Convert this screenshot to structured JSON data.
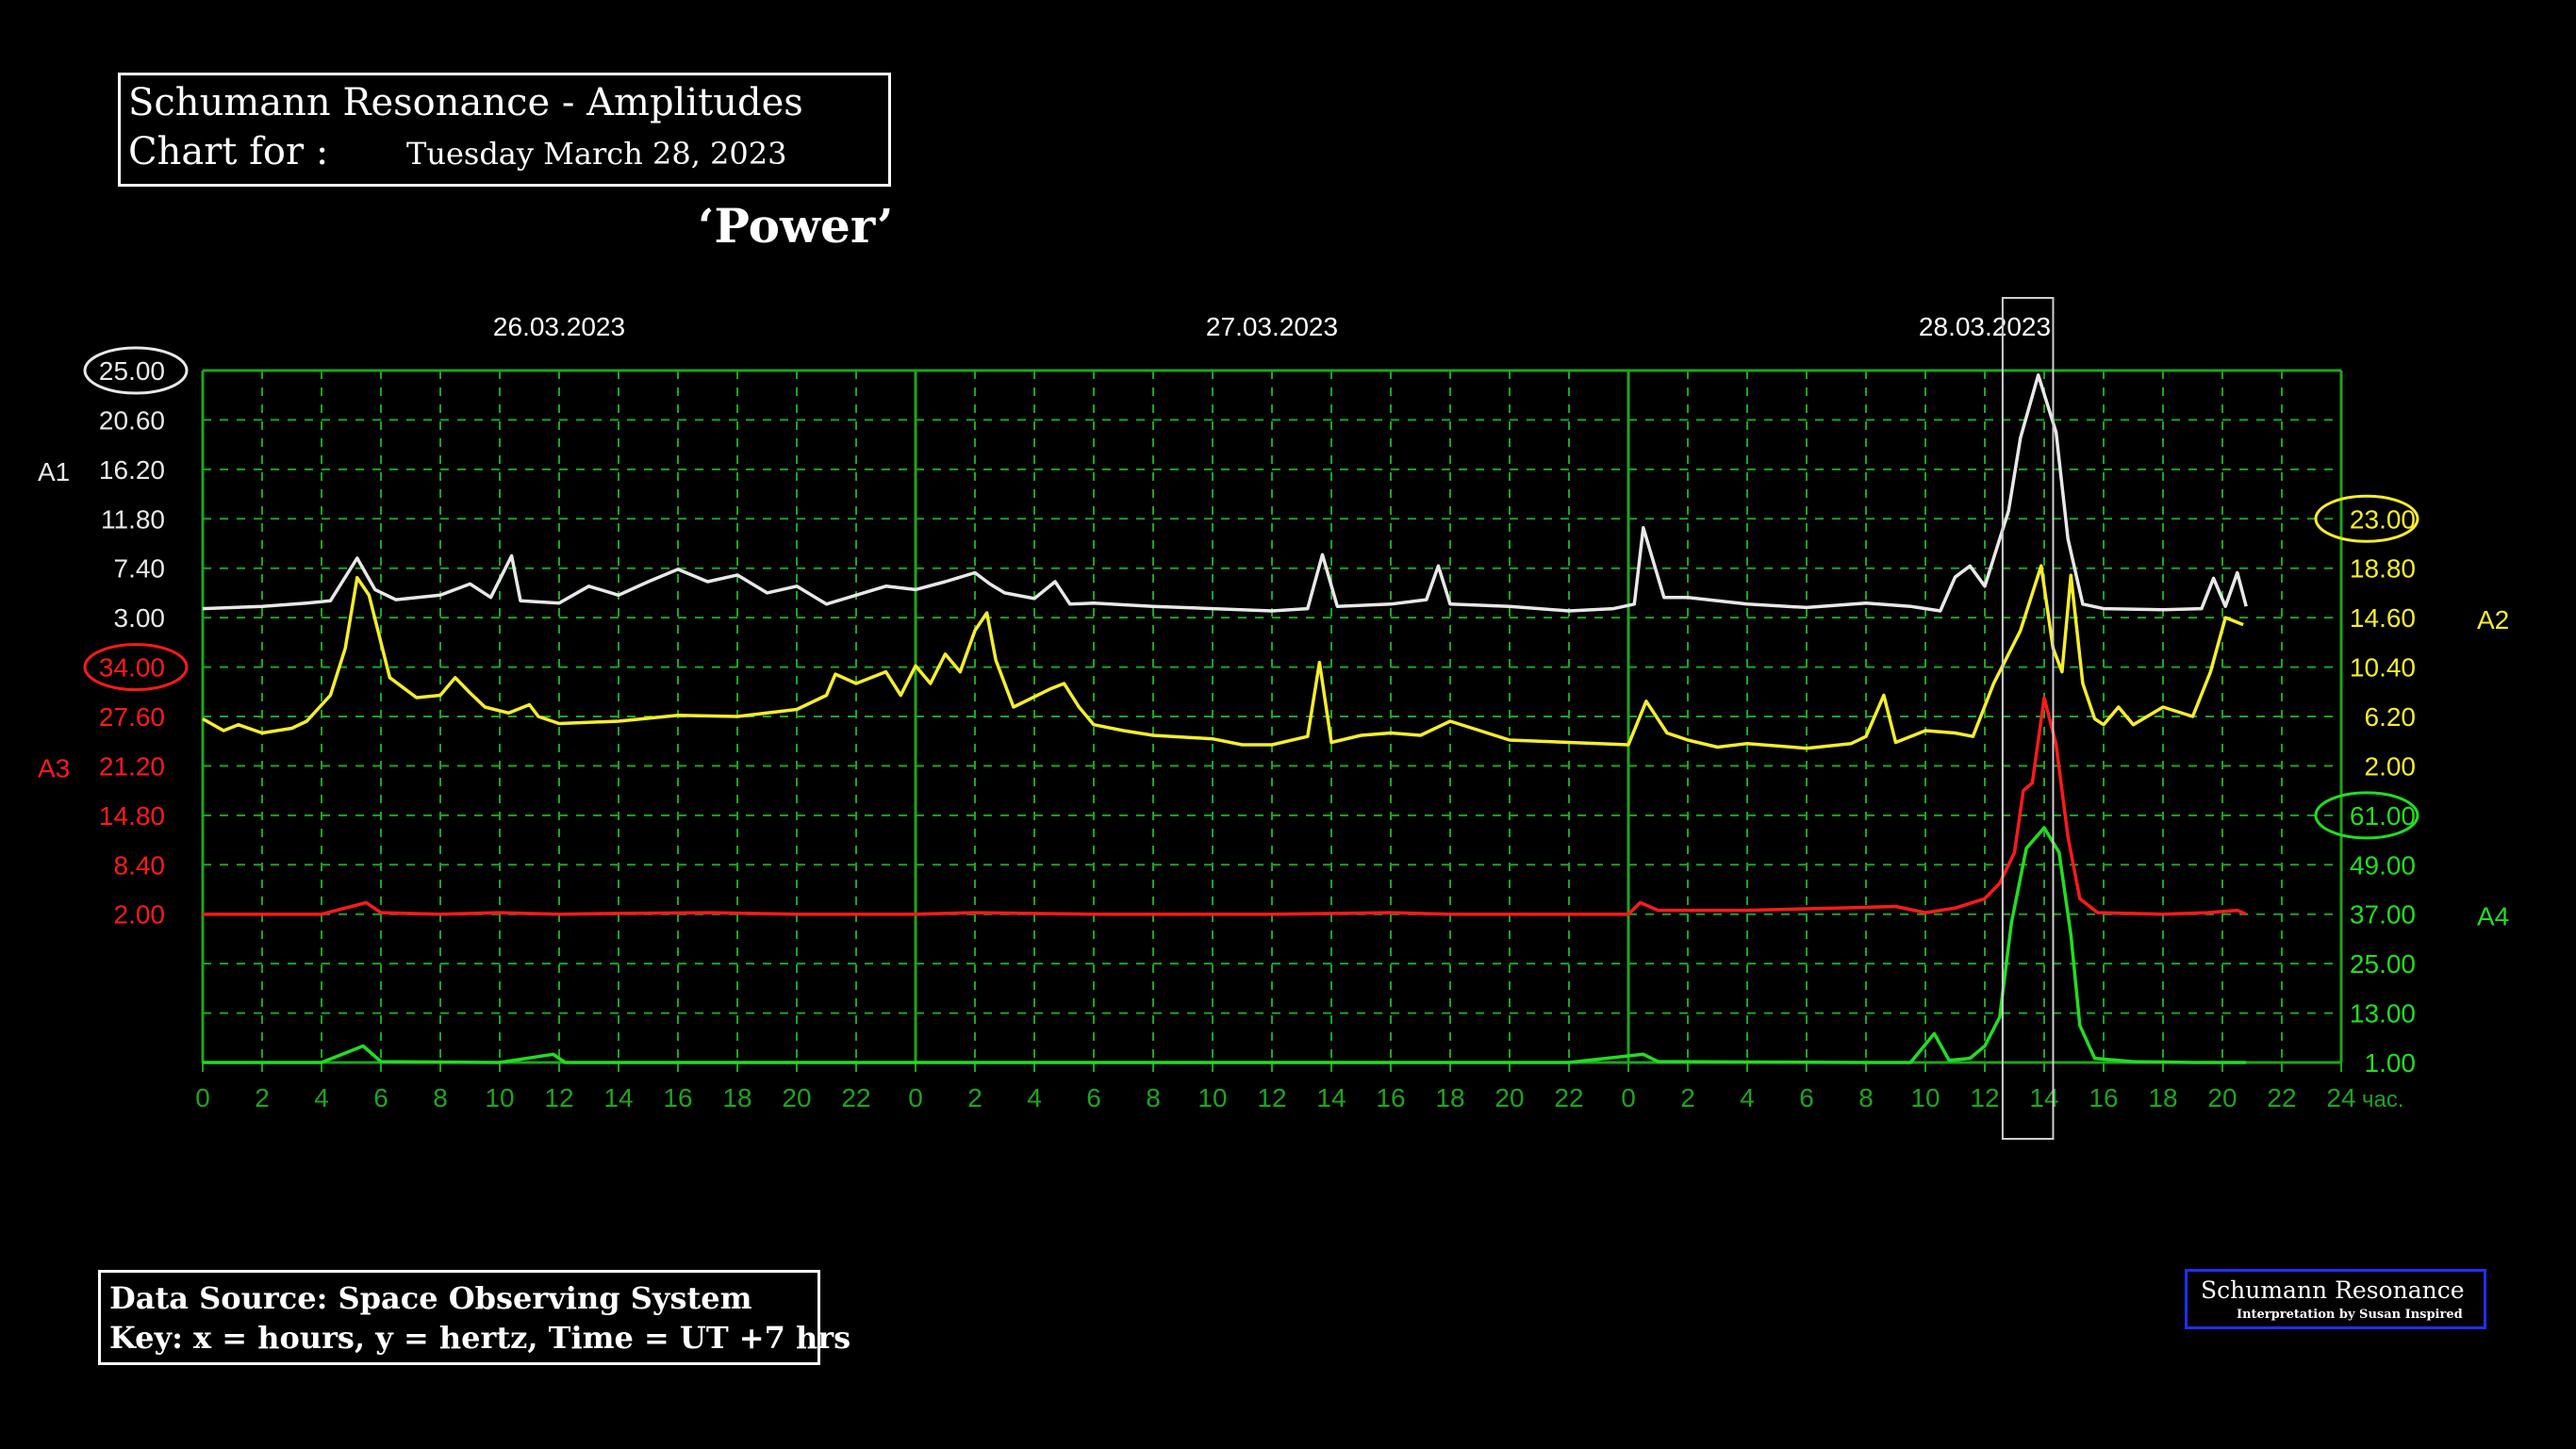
{
  "header": {
    "title": "Schumann Resonance - Amplitudes",
    "chart_for_label": "Chart for :",
    "date": "Tuesday March 28, 2023",
    "subtitle": "‘Power’"
  },
  "footer": {
    "source": "Data Source: Space Observing System",
    "key": "Key: x = hours, y = hertz, Time = UT +7 hrs"
  },
  "credit": {
    "title": "Schumann Resonance",
    "byline": "Interpretation by Susan Inspired"
  },
  "colors": {
    "background": "#000000",
    "grid": "#1fa51f",
    "a1": "#e8e8e8",
    "a2": "#f5ee2a",
    "a3": "#ff1a1a",
    "a4": "#22dd22",
    "credit_border": "#1f2fff"
  },
  "chart_data": {
    "type": "line",
    "day_labels": [
      "26.03.2023",
      "27.03.2023",
      "28.03.2023"
    ],
    "x_unit": "час.",
    "x_range_hours": [
      0,
      72
    ],
    "x_tick_labels": [
      "0",
      "2",
      "4",
      "6",
      "8",
      "10",
      "12",
      "14",
      "16",
      "18",
      "20",
      "22",
      "0",
      "2",
      "4",
      "6",
      "8",
      "10",
      "12",
      "14",
      "16",
      "18",
      "20",
      "22",
      "0",
      "2",
      "4",
      "6",
      "8",
      "10",
      "12",
      "14",
      "16",
      "18",
      "20",
      "22",
      "24"
    ],
    "axes": {
      "A1": {
        "label": "A1",
        "color": "#e8e8e8",
        "side": "left",
        "ticks": [
          "25.00",
          "20.60",
          "16.20",
          "11.80",
          "7.40",
          "3.00"
        ],
        "max": 25.0,
        "min": 3.0,
        "highlight": "25.00"
      },
      "A3": {
        "label": "A3",
        "color": "#ff1a1a",
        "side": "left",
        "ticks": [
          "34.00",
          "27.60",
          "21.20",
          "14.80",
          "8.40",
          "2.00"
        ],
        "max": 34.0,
        "min": 2.0,
        "highlight": "34.00"
      },
      "A2": {
        "label": "A2",
        "color": "#f5ee2a",
        "side": "right",
        "ticks": [
          "23.00",
          "18.80",
          "14.60",
          "10.40",
          "6.20",
          "2.00"
        ],
        "max": 23.0,
        "min": 2.0,
        "highlight": "23.00"
      },
      "A4": {
        "label": "A4",
        "color": "#22dd22",
        "side": "right",
        "ticks": [
          "61.00",
          "49.00",
          "37.00",
          "25.00",
          "13.00",
          "1.00"
        ],
        "max": 61.0,
        "min": 1.0,
        "highlight": "61.00"
      }
    },
    "grid": true,
    "highlight_window_hours": [
      60.6,
      62.3
    ],
    "series": [
      {
        "name": "A1",
        "axis": "A1",
        "color": "#e8e8e8",
        "points": [
          [
            0,
            3.8
          ],
          [
            2,
            4.0
          ],
          [
            3.5,
            4.3
          ],
          [
            4.3,
            4.5
          ],
          [
            5.2,
            8.3
          ],
          [
            5.8,
            5.5
          ],
          [
            6.5,
            4.6
          ],
          [
            8,
            5.0
          ],
          [
            9,
            6.0
          ],
          [
            9.7,
            4.8
          ],
          [
            10.4,
            8.5
          ],
          [
            10.7,
            4.5
          ],
          [
            12,
            4.3
          ],
          [
            13,
            5.8
          ],
          [
            14,
            5.0
          ],
          [
            15,
            6.2
          ],
          [
            16,
            7.3
          ],
          [
            17,
            6.2
          ],
          [
            18,
            6.8
          ],
          [
            19,
            5.2
          ],
          [
            20,
            5.8
          ],
          [
            21,
            4.2
          ],
          [
            22,
            5.0
          ],
          [
            23,
            5.8
          ],
          [
            24,
            5.5
          ],
          [
            25,
            6.2
          ],
          [
            26,
            7.0
          ],
          [
            26.5,
            6.0
          ],
          [
            27,
            5.2
          ],
          [
            28,
            4.7
          ],
          [
            28.7,
            6.2
          ],
          [
            29.2,
            4.2
          ],
          [
            30,
            4.3
          ],
          [
            32,
            4.0
          ],
          [
            34,
            3.8
          ],
          [
            36,
            3.6
          ],
          [
            37.2,
            3.8
          ],
          [
            37.7,
            8.6
          ],
          [
            38.2,
            4.0
          ],
          [
            40,
            4.2
          ],
          [
            41.2,
            4.6
          ],
          [
            41.6,
            7.6
          ],
          [
            42,
            4.2
          ],
          [
            44,
            4.0
          ],
          [
            46,
            3.6
          ],
          [
            47.5,
            3.8
          ],
          [
            48.2,
            4.2
          ],
          [
            48.5,
            11.0
          ],
          [
            49.2,
            4.8
          ],
          [
            50,
            4.8
          ],
          [
            52,
            4.2
          ],
          [
            54,
            3.9
          ],
          [
            56,
            4.3
          ],
          [
            57.5,
            4.0
          ],
          [
            58.5,
            3.6
          ],
          [
            59,
            6.6
          ],
          [
            59.5,
            7.6
          ],
          [
            60,
            5.8
          ],
          [
            60.8,
            12.5
          ],
          [
            61.2,
            19.0
          ],
          [
            61.8,
            24.6
          ],
          [
            62.4,
            19.5
          ],
          [
            62.8,
            10.0
          ],
          [
            63.3,
            4.2
          ],
          [
            64,
            3.8
          ],
          [
            66,
            3.7
          ],
          [
            67.3,
            3.8
          ],
          [
            67.7,
            6.5
          ],
          [
            68.1,
            4.0
          ],
          [
            68.5,
            7.0
          ],
          [
            68.8,
            4.0
          ]
        ]
      },
      {
        "name": "A2",
        "axis": "A2",
        "color": "#f5ee2a",
        "points": [
          [
            0,
            6.0
          ],
          [
            0.7,
            5.0
          ],
          [
            1.2,
            5.5
          ],
          [
            2,
            4.8
          ],
          [
            3,
            5.2
          ],
          [
            3.5,
            5.8
          ],
          [
            4.3,
            8.0
          ],
          [
            4.8,
            12.0
          ],
          [
            5.2,
            18.0
          ],
          [
            5.6,
            16.5
          ],
          [
            6.3,
            9.5
          ],
          [
            7.2,
            7.8
          ],
          [
            8,
            8.0
          ],
          [
            8.5,
            9.5
          ],
          [
            9,
            8.2
          ],
          [
            9.5,
            7.0
          ],
          [
            10.3,
            6.5
          ],
          [
            11,
            7.2
          ],
          [
            11.3,
            6.2
          ],
          [
            12,
            5.6
          ],
          [
            14,
            5.8
          ],
          [
            16,
            6.3
          ],
          [
            18,
            6.2
          ],
          [
            19,
            6.5
          ],
          [
            20,
            6.8
          ],
          [
            21,
            8.0
          ],
          [
            21.3,
            9.8
          ],
          [
            22,
            9.0
          ],
          [
            23,
            10.0
          ],
          [
            23.5,
            8.0
          ],
          [
            24,
            10.5
          ],
          [
            24.5,
            9.0
          ],
          [
            25,
            11.5
          ],
          [
            25.5,
            10.0
          ],
          [
            26,
            13.5
          ],
          [
            26.4,
            15.0
          ],
          [
            26.7,
            11.0
          ],
          [
            27.3,
            7.0
          ],
          [
            28.5,
            8.5
          ],
          [
            29,
            9.0
          ],
          [
            29.5,
            7.0
          ],
          [
            30,
            5.5
          ],
          [
            31,
            5.0
          ],
          [
            32,
            4.6
          ],
          [
            34,
            4.3
          ],
          [
            35,
            3.8
          ],
          [
            36,
            3.8
          ],
          [
            37.2,
            4.5
          ],
          [
            37.6,
            10.8
          ],
          [
            38,
            4.0
          ],
          [
            39,
            4.6
          ],
          [
            40,
            4.8
          ],
          [
            41,
            4.6
          ],
          [
            42,
            5.8
          ],
          [
            43,
            5.0
          ],
          [
            44,
            4.2
          ],
          [
            46,
            4.0
          ],
          [
            48,
            3.8
          ],
          [
            48.6,
            7.5
          ],
          [
            49.3,
            4.8
          ],
          [
            50,
            4.2
          ],
          [
            51,
            3.6
          ],
          [
            52,
            3.9
          ],
          [
            54,
            3.5
          ],
          [
            55.5,
            3.9
          ],
          [
            56,
            4.5
          ],
          [
            56.6,
            8.0
          ],
          [
            57,
            4.0
          ],
          [
            58,
            5.0
          ],
          [
            59,
            4.8
          ],
          [
            59.6,
            4.5
          ],
          [
            60.3,
            9.0
          ],
          [
            61.2,
            13.5
          ],
          [
            61.9,
            19.0
          ],
          [
            62.3,
            12.0
          ],
          [
            62.6,
            10.0
          ],
          [
            62.9,
            18.2
          ],
          [
            63.3,
            9.0
          ],
          [
            63.7,
            6.0
          ],
          [
            64,
            5.5
          ],
          [
            64.5,
            7.0
          ],
          [
            65,
            5.5
          ],
          [
            66,
            7.0
          ],
          [
            67,
            6.2
          ],
          [
            67.6,
            10.0
          ],
          [
            68.1,
            14.6
          ],
          [
            68.7,
            14.0
          ]
        ]
      },
      {
        "name": "A3",
        "axis": "A3",
        "color": "#ff1a1a",
        "points": [
          [
            0,
            2.0
          ],
          [
            4,
            2.0
          ],
          [
            5.5,
            3.5
          ],
          [
            6,
            2.2
          ],
          [
            8,
            2.0
          ],
          [
            10,
            2.2
          ],
          [
            12,
            2.0
          ],
          [
            14,
            2.1
          ],
          [
            17,
            2.2
          ],
          [
            20,
            2.0
          ],
          [
            24,
            2.0
          ],
          [
            26,
            2.2
          ],
          [
            30,
            2.0
          ],
          [
            36,
            2.0
          ],
          [
            40,
            2.2
          ],
          [
            42,
            2.0
          ],
          [
            48,
            2.0
          ],
          [
            48.4,
            3.5
          ],
          [
            49,
            2.5
          ],
          [
            52,
            2.5
          ],
          [
            55,
            2.8
          ],
          [
            57,
            3.0
          ],
          [
            58,
            2.2
          ],
          [
            59,
            2.8
          ],
          [
            60,
            4.0
          ],
          [
            60.5,
            6.0
          ],
          [
            61,
            10.0
          ],
          [
            61.3,
            18.0
          ],
          [
            61.6,
            19.0
          ],
          [
            62,
            30.0
          ],
          [
            62.4,
            24.0
          ],
          [
            62.8,
            12.0
          ],
          [
            63.2,
            4.0
          ],
          [
            63.8,
            2.2
          ],
          [
            66,
            2.0
          ],
          [
            67.5,
            2.2
          ],
          [
            68.5,
            2.5
          ],
          [
            68.8,
            2.0
          ]
        ]
      },
      {
        "name": "A4",
        "axis": "A4",
        "color": "#22dd22",
        "points": [
          [
            0,
            1.0
          ],
          [
            4,
            1.0
          ],
          [
            5.4,
            5.0
          ],
          [
            6,
            1.2
          ],
          [
            10,
            1.0
          ],
          [
            11.8,
            3.0
          ],
          [
            12.2,
            1.0
          ],
          [
            20,
            1.0
          ],
          [
            24,
            1.0
          ],
          [
            30,
            1.0
          ],
          [
            36,
            1.0
          ],
          [
            40,
            1.0
          ],
          [
            46,
            1.0
          ],
          [
            48.5,
            3.0
          ],
          [
            49,
            1.2
          ],
          [
            56,
            1.0
          ],
          [
            57.5,
            1.0
          ],
          [
            58.3,
            8.0
          ],
          [
            58.8,
            1.5
          ],
          [
            59.5,
            2.0
          ],
          [
            60,
            5.0
          ],
          [
            60.5,
            12.0
          ],
          [
            60.9,
            35.0
          ],
          [
            61.4,
            53.0
          ],
          [
            62.0,
            58.0
          ],
          [
            62.5,
            52.0
          ],
          [
            62.9,
            32.0
          ],
          [
            63.2,
            10.0
          ],
          [
            63.7,
            2.0
          ],
          [
            65,
            1.2
          ],
          [
            67,
            1.0
          ],
          [
            68.8,
            1.0
          ]
        ]
      }
    ]
  }
}
